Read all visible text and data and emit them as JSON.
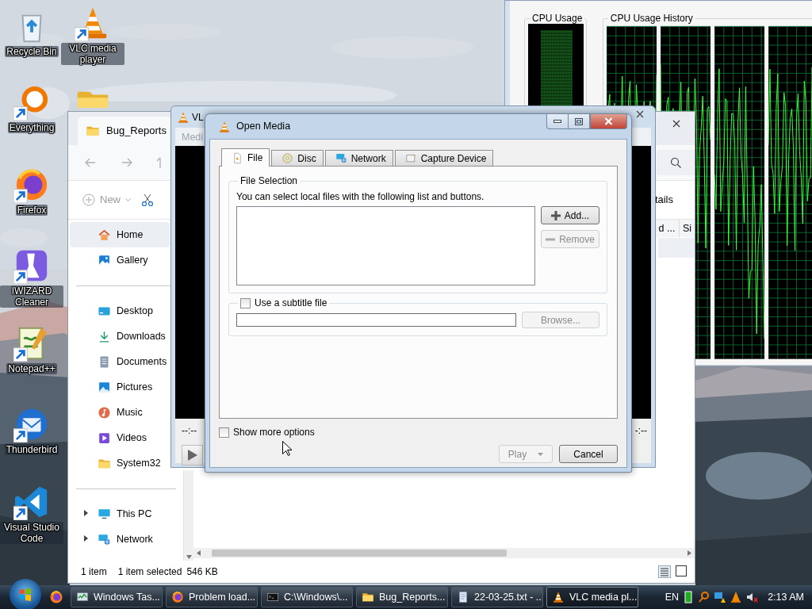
{
  "desktop_icons": [
    {
      "label": "Recycle Bin",
      "kind": "recycle",
      "shortcut": false
    },
    {
      "label": "VLC media player",
      "kind": "vlc",
      "shortcut": true
    },
    {
      "kind": "folder",
      "shortcut": false
    },
    {
      "label": "Everything",
      "kind": "everything",
      "shortcut": true
    },
    {
      "label": "Firefox",
      "kind": "firefox",
      "shortcut": true
    },
    {
      "label": "IWIZARD Cleaner",
      "kind": "wizard",
      "shortcut": true
    },
    {
      "label": "Notepad++",
      "kind": "notepad",
      "shortcut": true
    },
    {
      "label": "Thunderbird",
      "kind": "thunderbird",
      "shortcut": true
    },
    {
      "label": "Visual Studio Code",
      "kind": "vscode",
      "shortcut": true
    }
  ],
  "task_manager": {
    "cpu_usage_label": "CPU Usage",
    "cpu_history_label": "CPU Usage History"
  },
  "explorer": {
    "tab_title": "Bug_Reports",
    "new_button": "New",
    "toolbar_cut_text": "tails",
    "columns": [
      "d ...",
      "Si"
    ],
    "sidebar_groups": [
      {
        "items": [
          {
            "label": "Home",
            "kind": "home",
            "selected": true
          },
          {
            "label": "Gallery",
            "kind": "gallery",
            "selected": false
          }
        ]
      },
      {
        "items": [
          {
            "label": "Desktop",
            "kind": "desktop",
            "selected": false
          },
          {
            "label": "Downloads",
            "kind": "downloads",
            "selected": false
          },
          {
            "label": "Documents",
            "kind": "documents",
            "selected": false
          },
          {
            "label": "Pictures",
            "kind": "pictures",
            "selected": false
          },
          {
            "label": "Music",
            "kind": "music",
            "selected": false
          },
          {
            "label": "Videos",
            "kind": "videos",
            "selected": false
          },
          {
            "label": "System32",
            "kind": "folder",
            "selected": false
          }
        ]
      },
      {
        "items": [
          {
            "label": "This PC",
            "kind": "thispc",
            "selected": false,
            "expanded": false
          },
          {
            "label": "Network",
            "kind": "network",
            "selected": false,
            "expanded": false
          }
        ]
      }
    ],
    "status": [
      "1 item",
      "1 item selected",
      "546 KB"
    ]
  },
  "vlc_window": {
    "title": "VL",
    "menu": "Medi",
    "time_left": "--:--",
    "time_right": "-:--"
  },
  "open_media": {
    "title": "Open Media",
    "tabs": [
      {
        "label": "File",
        "kind": "file",
        "selected": true
      },
      {
        "label": "Disc",
        "kind": "disc",
        "selected": false
      },
      {
        "label": "Network",
        "kind": "network",
        "selected": false
      },
      {
        "label": "Capture Device",
        "kind": "capture",
        "selected": false
      }
    ],
    "group_title": "File Selection",
    "hint": "You can select local files with the following list and buttons.",
    "add_button": {
      "label": "Add...",
      "disabled": false
    },
    "remove_button": {
      "label": "Remove",
      "disabled": true
    },
    "subtitle": {
      "label": "Use a subtitle file",
      "checked": false
    },
    "browse_button": {
      "label": "Browse...",
      "disabled": true
    },
    "show_more": {
      "label": "Show more options",
      "checked": false
    },
    "play_button": {
      "label": "Play",
      "disabled": true
    },
    "cancel_button": {
      "label": "Cancel",
      "disabled": false
    }
  },
  "taskbar": {
    "items": [
      {
        "label": "Windows Tas...",
        "kind": "taskmgr",
        "selected": false
      },
      {
        "label": "Problem load...",
        "kind": "firefox",
        "selected": false
      },
      {
        "label": "C:\\Windows\\...",
        "kind": "cmd",
        "selected": false
      },
      {
        "label": "Bug_Reports...",
        "kind": "folder",
        "selected": false
      },
      {
        "label": "22-03-25.txt - ...",
        "kind": "txt",
        "selected": false
      },
      {
        "label": "VLC media pl...",
        "kind": "vlc",
        "selected": true
      }
    ],
    "language": "EN",
    "clock": "2:13 AM"
  }
}
